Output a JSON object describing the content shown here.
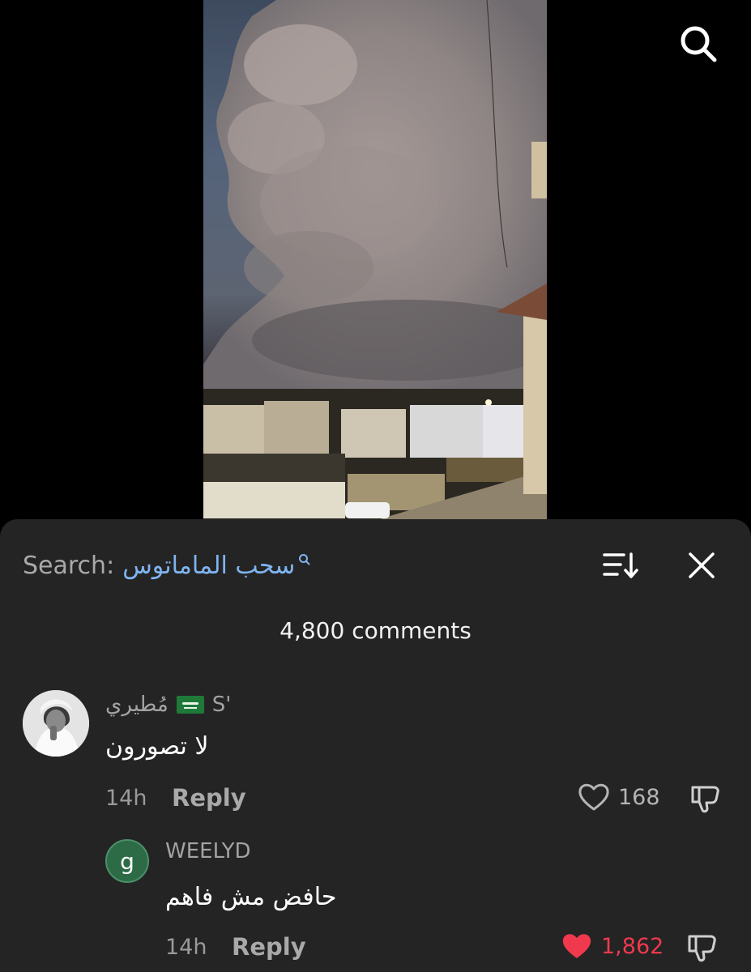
{
  "search": {
    "label": "Search:",
    "query": "سحب الماماتوس"
  },
  "comments_header": {
    "count_text": "4,800 comments"
  },
  "comments": [
    {
      "username": "مُطيري 🇸🇦 S'",
      "username_text": "مُطيري",
      "username_suffix": "S'",
      "text": "لا تصورون",
      "time": "14h",
      "reply_label": "Reply",
      "likes": "168",
      "liked": false
    },
    {
      "avatar_letter": "g",
      "username": "WEELYD",
      "text": "حافض مش فاهم",
      "time": "14h",
      "reply_label": "Reply",
      "likes": "1,862",
      "liked": true
    }
  ],
  "colors": {
    "sheet_bg": "#242424",
    "search_query": "#7fb4f0",
    "liked_heart": "#f0394d",
    "avatar_green": "#2d6b47"
  },
  "icons": [
    "search-icon",
    "sort-icon",
    "close-icon",
    "heart-outline-icon",
    "heart-filled-icon",
    "dislike-icon"
  ]
}
